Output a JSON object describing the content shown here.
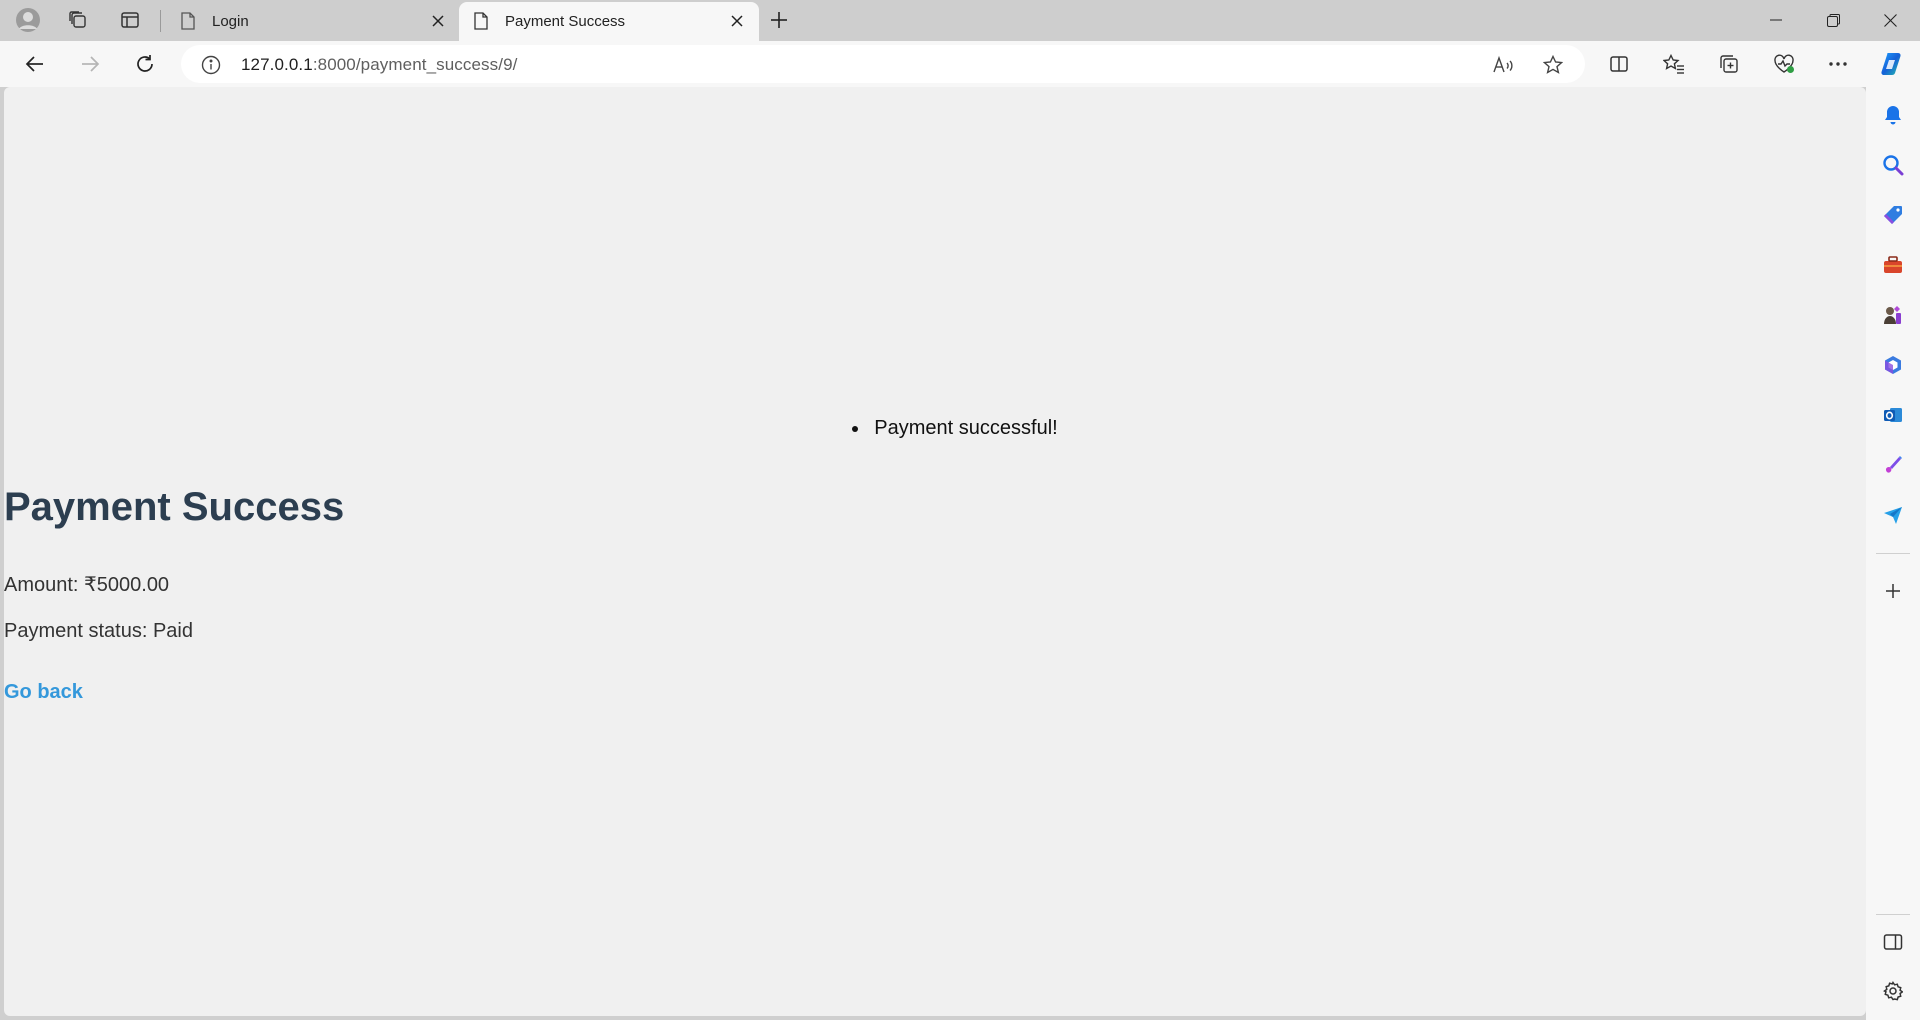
{
  "browser": {
    "tabs": [
      {
        "title": "Login",
        "active": false
      },
      {
        "title": "Payment Success",
        "active": true
      }
    ],
    "url_host": "127.0.0.1",
    "url_rest": ":8000/payment_success/9/",
    "window_controls": [
      "minimize",
      "restore",
      "close"
    ]
  },
  "page": {
    "messages": [
      "Payment successful!"
    ],
    "title": "Payment Success",
    "amount_text": "Amount: ₹5000.00",
    "status_text": "Payment status: Paid",
    "back_link": "Go back"
  },
  "colors": {
    "title": "#2c3e50",
    "link": "#3498db",
    "page_bg": "#f0f0f0"
  },
  "sidebar_icons": [
    "bell-icon",
    "search-icon",
    "shopping-tag-icon",
    "toolbox-icon",
    "games-icon",
    "microsoft365-icon",
    "outlook-icon",
    "designer-icon",
    "send-icon",
    "add-icon",
    "hide-sidebar-icon",
    "settings-icon"
  ]
}
